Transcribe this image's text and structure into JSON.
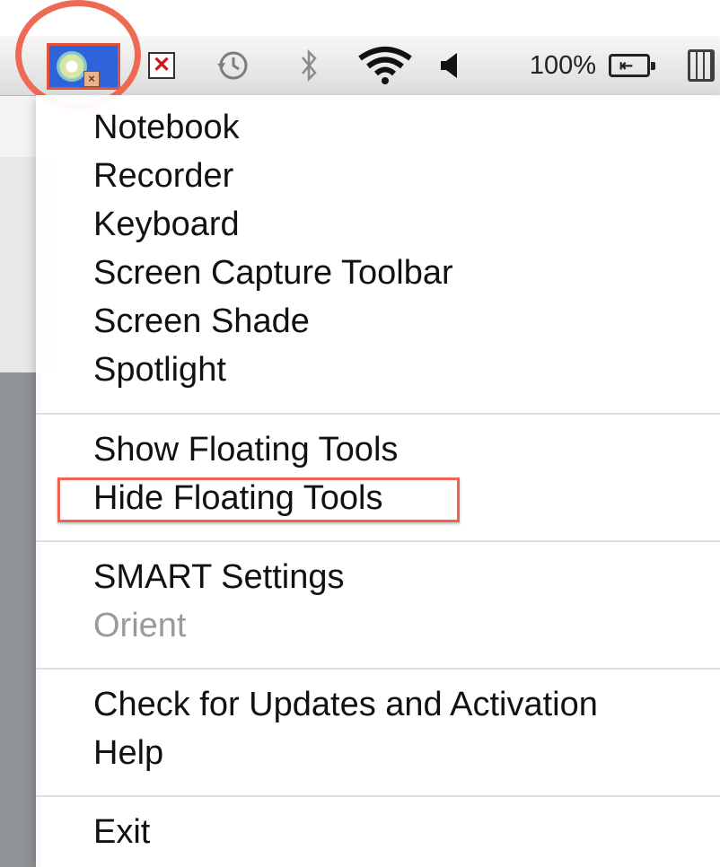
{
  "menubar": {
    "app_icon": "smart-board-tools-icon",
    "status_icons": [
      "close-x-icon",
      "time-machine-icon",
      "bluetooth-icon",
      "wifi-icon",
      "volume-icon"
    ],
    "battery_label": "100%",
    "battery_icon": "battery-charging-icon",
    "clock_icon": "calendar-icon"
  },
  "menu": {
    "group1": [
      "Notebook",
      "Recorder",
      "Keyboard",
      "Screen Capture Toolbar",
      "Screen Shade",
      "Spotlight"
    ],
    "group2": [
      "Show Floating Tools",
      "Hide Floating Tools"
    ],
    "group3": [
      "SMART Settings",
      "Orient"
    ],
    "group4": [
      "Check for Updates and Activation",
      "Help"
    ],
    "group5": [
      "Exit"
    ]
  },
  "colors": {
    "annotation": "#ee6452",
    "app_icon_bg": "#2f63d9",
    "disabled_text": "#9a9a9a"
  }
}
